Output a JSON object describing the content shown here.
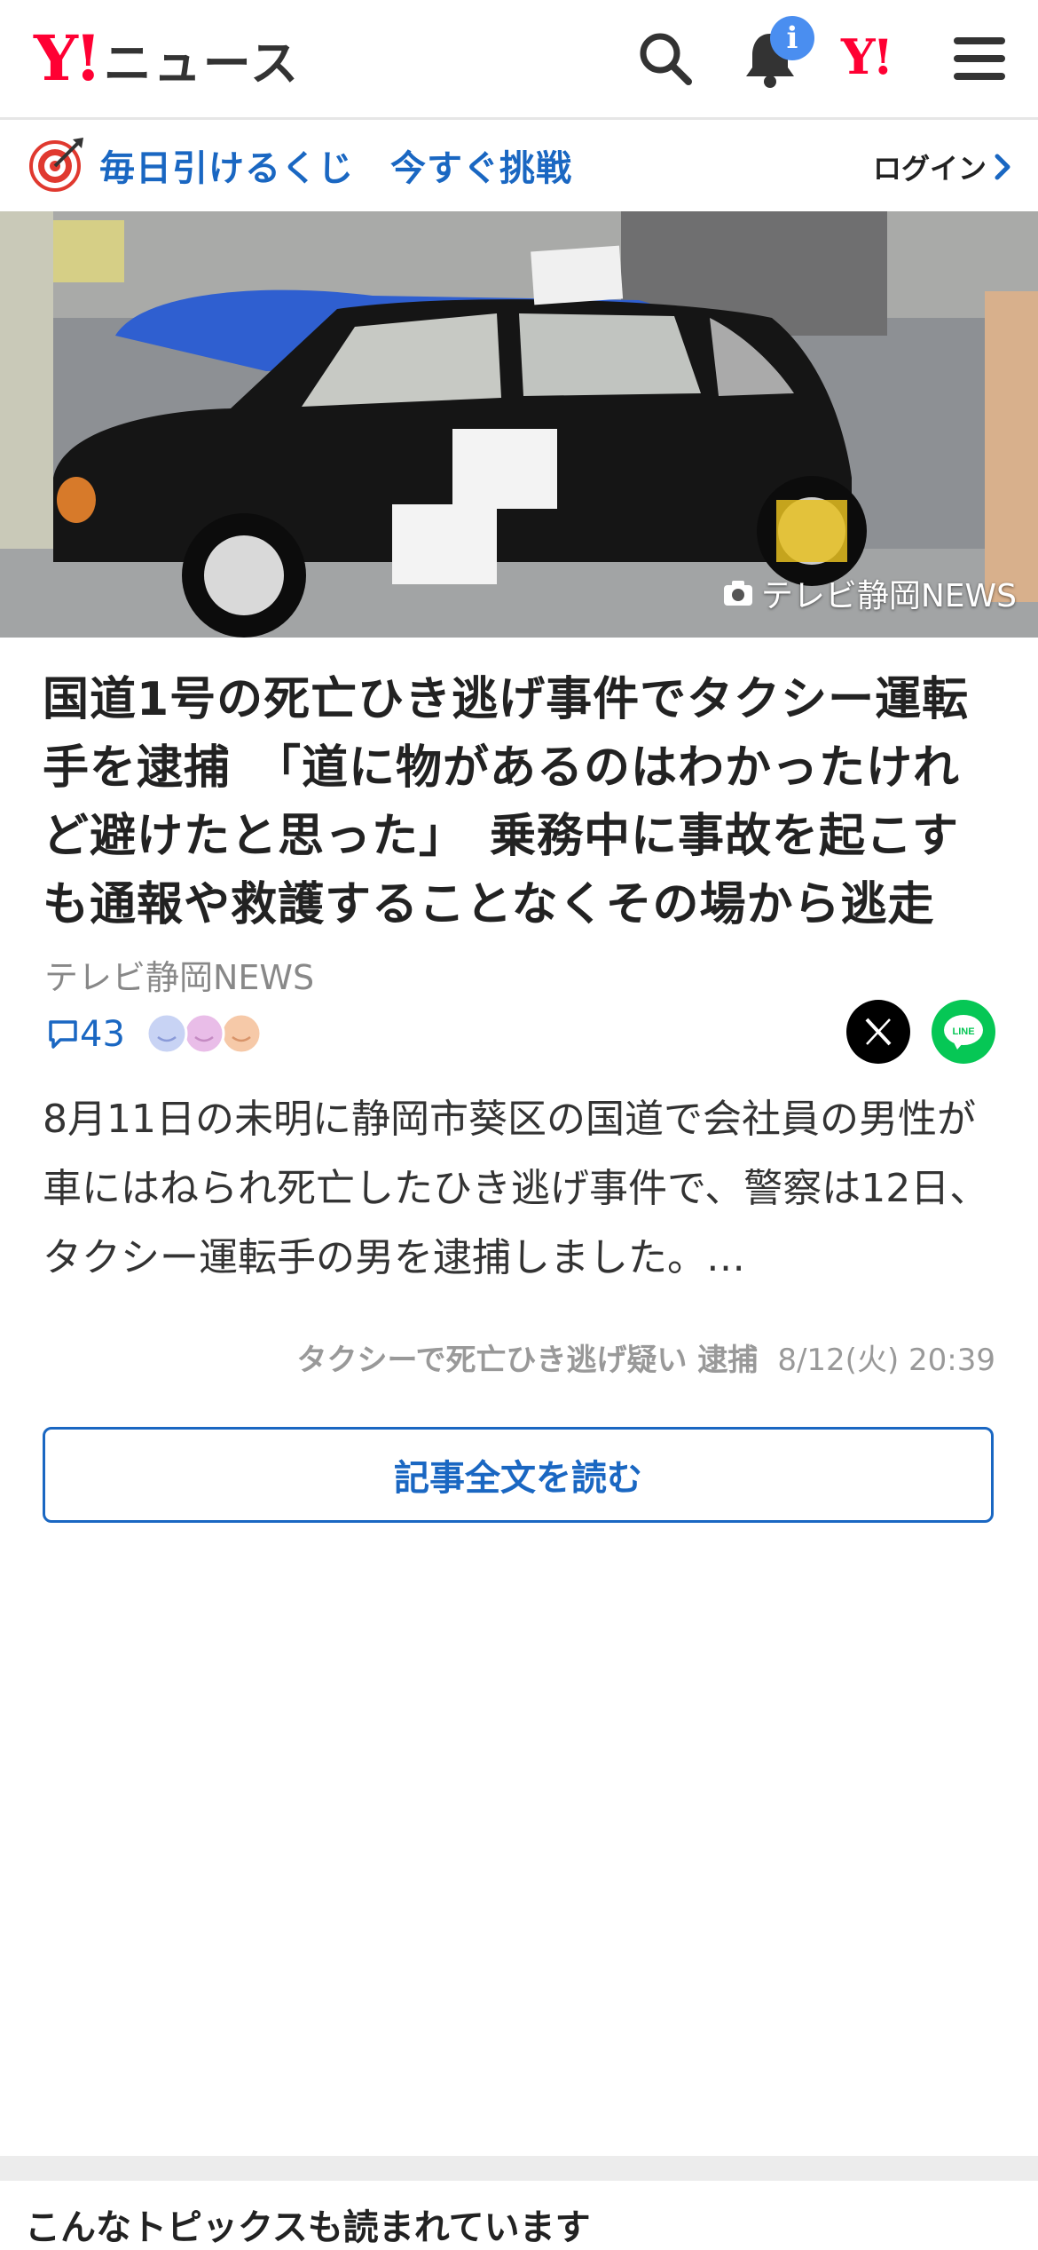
{
  "header": {
    "logo_mark": "Y!",
    "logo_text": "ニュース",
    "notification_badge": "i",
    "yahoo_mark": "Y!",
    "icons": [
      "search-icon",
      "bell-icon",
      "yahoo-icon",
      "hamburger-menu-icon"
    ]
  },
  "promo": {
    "text": "毎日引けるくじ　今すぐ挑戦",
    "login_label": "ログイン"
  },
  "hero": {
    "photo_credit": "テレビ静岡NEWS"
  },
  "article": {
    "title": "国道1号の死亡ひき逃げ事件でタクシー運転手を逮捕　「道に物があるのはわかったけれど避けたと思った」　乗務中に事故を起こすも通報や救護することなくその場から逃走",
    "source": "テレビ静岡NEWS",
    "comment_count": "43",
    "summary": "8月11日の未明に静岡市葵区の国道で会社員の男性が車にはねられ死亡したひき逃げ事件で、警察は12日、タクシー運転手の男を逮捕しました。…",
    "topic": "タクシーで死亡ひき逃げ疑い 逮捕",
    "datetime": "8/12(火) 20:39",
    "read_button": "記事全文を読む"
  },
  "share": {
    "x_label": "X",
    "line_label": "LINE"
  },
  "next_section": {
    "heading": "こんなトピックスも読まれています"
  },
  "colors": {
    "accent_blue": "#1a67c2",
    "yahoo_red": "#ff0033",
    "line_green": "#06c755"
  }
}
